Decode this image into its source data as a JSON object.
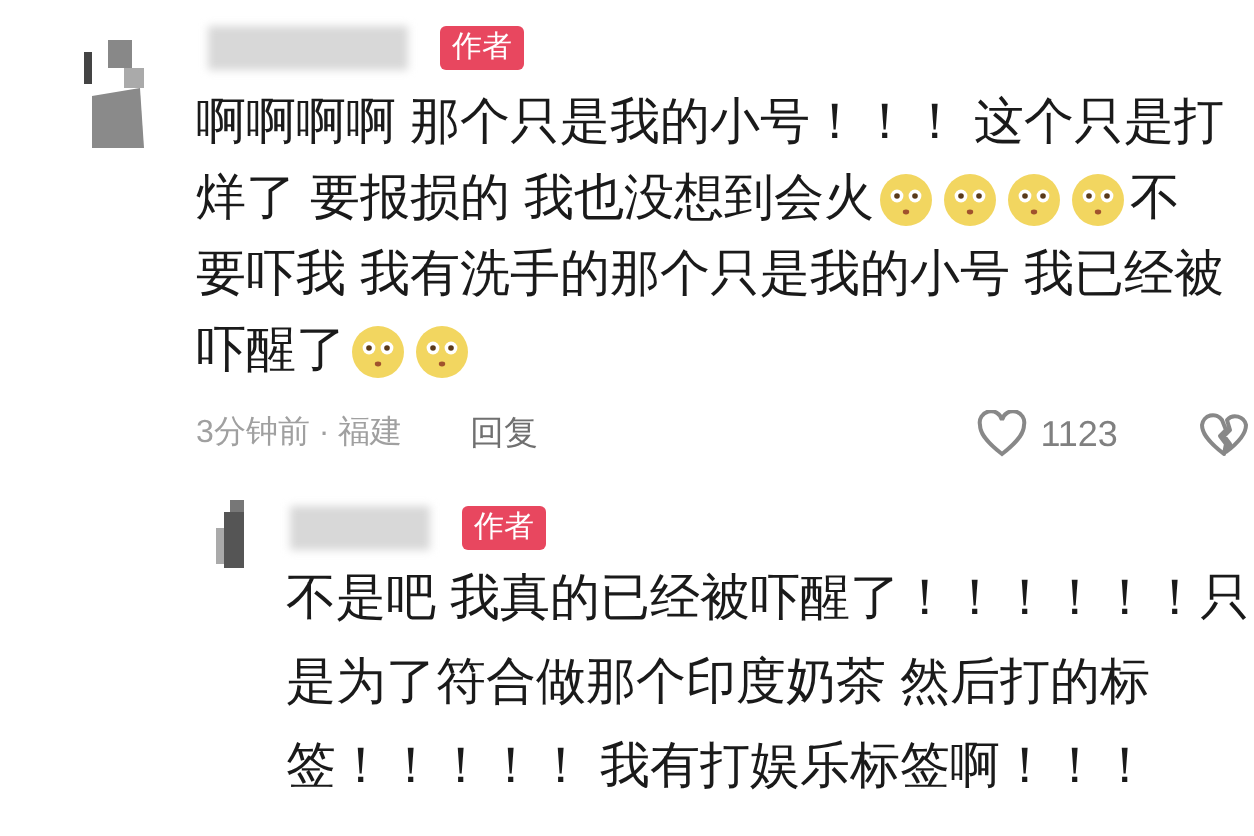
{
  "comments": [
    {
      "author_tag": "作者",
      "lines": [
        [
          {
            "kind": "text",
            "text": "啊啊啊啊 那个只是我的小号！！！ 这个只是打"
          }
        ],
        [
          {
            "kind": "text",
            "text": "烊了 要报损的 我也没想到会火"
          },
          {
            "kind": "emoji"
          },
          {
            "kind": "emoji"
          },
          {
            "kind": "emoji"
          },
          {
            "kind": "emoji"
          },
          {
            "kind": "text",
            "text": " 不"
          }
        ],
        [
          {
            "kind": "text",
            "text": "要吓我 我有洗手的那个只是我的小号 我已经被"
          }
        ],
        [
          {
            "kind": "text",
            "text": "吓醒了"
          },
          {
            "kind": "emoji"
          },
          {
            "kind": "emoji"
          }
        ]
      ],
      "time_location": "3分钟前 · 福建",
      "reply_label": "回复",
      "likes": "1123",
      "replies": [
        {
          "author_tag": "作者",
          "lines": [
            [
              {
                "kind": "text",
                "text": "不是吧 我真的已经被吓醒了！！！！！！只"
              }
            ],
            [
              {
                "kind": "text",
                "text": "是为了符合做那个印度奶茶 然后打的标"
              }
            ],
            [
              {
                "kind": "text",
                "text": "签！！！！！ 我有打娱乐标签啊！！！"
              }
            ]
          ]
        }
      ]
    }
  ]
}
